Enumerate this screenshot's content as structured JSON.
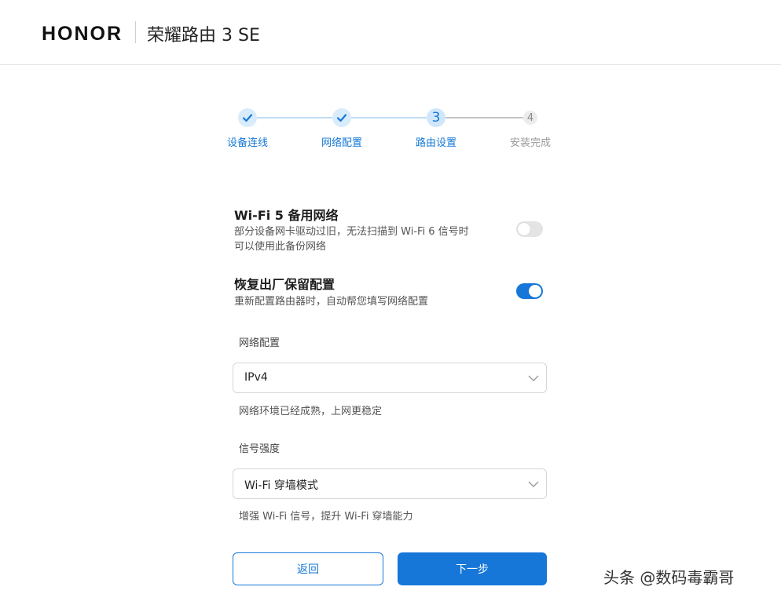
{
  "header": {
    "logo": "HONOR",
    "product": "荣耀路由 3 SE"
  },
  "stepper": {
    "steps": [
      {
        "label": "设备连线",
        "status": "done"
      },
      {
        "label": "网络配置",
        "status": "done"
      },
      {
        "label": "路由设置",
        "status": "current",
        "number": "3"
      },
      {
        "label": "安装完成",
        "status": "todo",
        "number": "4"
      }
    ]
  },
  "options": {
    "wifi5": {
      "title": "Wi-Fi 5 备用网络",
      "desc_line1": "部分设备网卡驱动过旧，无法扫描到 Wi-Fi 6 信号时",
      "desc_line2": "可以使用此备份网络",
      "enabled": false
    },
    "restore": {
      "title": "恢复出厂保留配置",
      "desc": "重新配置路由器时，自动帮您填写网络配置",
      "enabled": true
    }
  },
  "network": {
    "label": "网络配置",
    "value": "IPv4",
    "hint": "网络环境已经成熟，上网更稳定"
  },
  "signal": {
    "label": "信号强度",
    "value": "Wi-Fi 穿墙模式",
    "hint": "增强 Wi-Fi 信号，提升 Wi-Fi 穿墙能力"
  },
  "buttons": {
    "back": "返回",
    "next": "下一步"
  },
  "watermark": "头条 @数码毒霸哥",
  "colors": {
    "accent": "#1677d9",
    "step_done_bg": "#d8ecfb",
    "toggle_off": "#e4e4e4"
  }
}
